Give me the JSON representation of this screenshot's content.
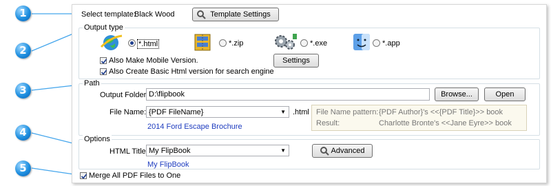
{
  "callouts": [
    "1",
    "2",
    "3",
    "4",
    "5"
  ],
  "template": {
    "label": "Select template:",
    "value": "Black Wood",
    "button": "Template Settings"
  },
  "output_type": {
    "legend": "Output type",
    "options": [
      {
        "label": "*.html",
        "selected": true,
        "icon": "globe-icon"
      },
      {
        "label": "*.zip",
        "selected": false,
        "icon": "zip-archive-icon"
      },
      {
        "label": "*.exe",
        "selected": false,
        "icon": "gears-icon"
      },
      {
        "label": "*.app",
        "selected": false,
        "icon": "mac-finder-icon"
      }
    ],
    "mobile_version": "Also Make Mobile Version.",
    "basic_html": "Also Create Basic Html version for search engine",
    "settings_button": "Settings"
  },
  "path": {
    "legend": "Path",
    "output_folder_label": "Output Folder:",
    "output_folder_value": "D:\\flipbook",
    "browse_button": "Browse...",
    "open_button": "Open",
    "file_name_label": "File Name:",
    "file_name_value": "{PDF FileName}",
    "file_ext": ".html",
    "file_name_preview": "2014 Ford Escape Brochure",
    "pattern_label": "File Name pattern:",
    "pattern_value": "{PDF Author}'s <<{PDF Title}>> book",
    "result_label": "Result:",
    "result_value": "Charlotte Bronte's <<Jane Eyre>> book"
  },
  "options": {
    "legend": "Options",
    "html_title_label": "HTML Title:",
    "html_title_value": "My FlipBook",
    "html_title_preview": "My FlipBook",
    "advanced_button": "Advanced"
  },
  "merge": {
    "label": "Merge All PDF Files to One",
    "checked": true
  },
  "colors": {
    "callout_blue": "#1e8fe0",
    "link_blue": "#1e3cbf",
    "pattern_box_bg": "#fbf9ee"
  }
}
